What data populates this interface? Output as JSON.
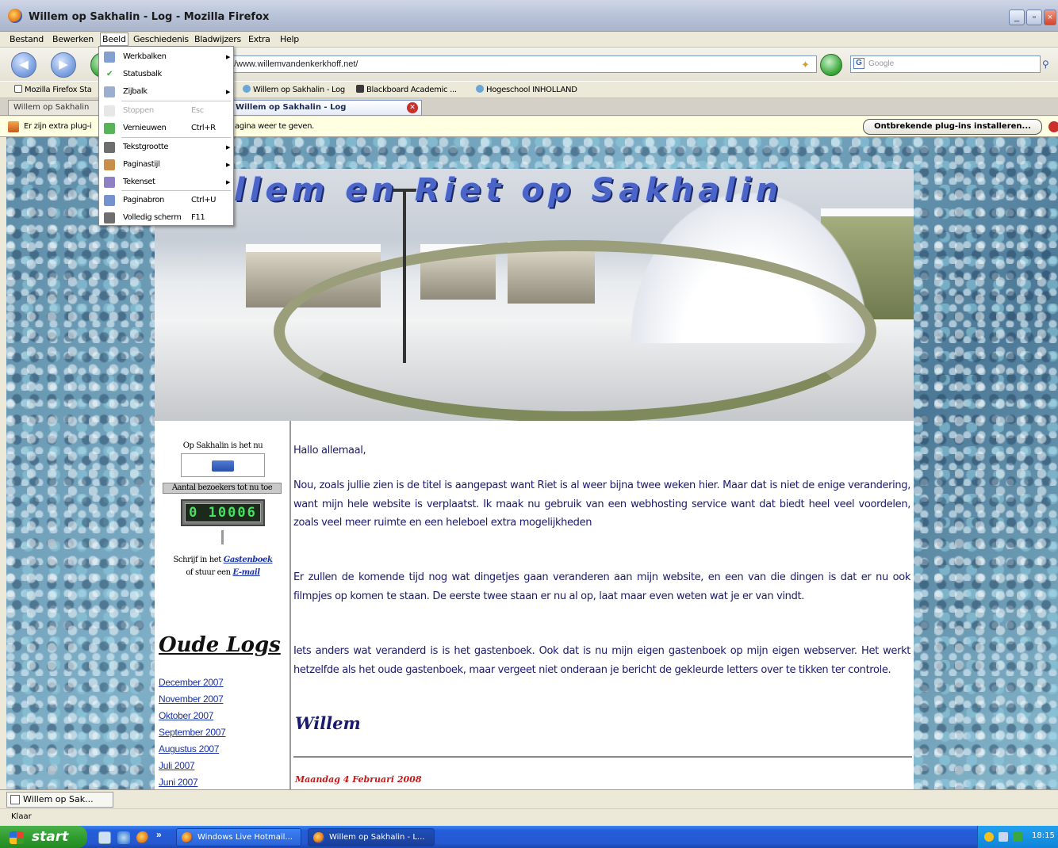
{
  "window": {
    "title": "Willem op Sakhalin - Log - Mozilla Firefox"
  },
  "menubar": {
    "items": [
      "Bestand",
      "Bewerken",
      "Beeld",
      "Geschiedenis",
      "Bladwijzers",
      "Extra",
      "Help"
    ]
  },
  "navbar": {
    "url": "://www.willemvandenkerkhoff.net/",
    "search_placeholder": "Google"
  },
  "bookmarks": [
    "Mozilla Firefox Sta",
    "Willem op Sakhalin - Log",
    "Blackboard Academic ...",
    "Hogeschool INHOLLAND"
  ],
  "tabs": [
    {
      "label": "Willem op Sakhalin"
    },
    {
      "label": "Willem op Sakhalin - Log"
    }
  ],
  "notification": {
    "message_start": "Er zijn extra plug-i",
    "message_end": "agina weer te geven.",
    "button": "Ontbrekende plug-ins installeren..."
  },
  "dropdown": {
    "items": [
      {
        "label": "Werkbalken",
        "shortcut": "",
        "submenu": true,
        "disabled": false,
        "icon": "toolbars-icon"
      },
      {
        "label": "Statusbalk",
        "shortcut": "",
        "submenu": false,
        "disabled": false,
        "icon": "checkmark-icon"
      },
      {
        "label": "Zijbalk",
        "shortcut": "",
        "submenu": true,
        "disabled": false,
        "icon": "sidebar-icon"
      },
      {
        "label": "Stoppen",
        "shortcut": "Esc",
        "submenu": false,
        "disabled": true,
        "icon": "stop-icon"
      },
      {
        "label": "Vernieuwen",
        "shortcut": "Ctrl+R",
        "submenu": false,
        "disabled": false,
        "icon": "reload-icon"
      },
      {
        "label": "Tekstgrootte",
        "shortcut": "",
        "submenu": true,
        "disabled": false,
        "icon": "text-size-icon"
      },
      {
        "label": "Paginastijl",
        "shortcut": "",
        "submenu": true,
        "disabled": false,
        "icon": "page-style-icon"
      },
      {
        "label": "Tekenset",
        "shortcut": "",
        "submenu": true,
        "disabled": false,
        "icon": "charset-icon"
      },
      {
        "label": "Paginabron",
        "shortcut": "Ctrl+U",
        "submenu": false,
        "disabled": false,
        "icon": "page-source-icon"
      },
      {
        "label": "Volledig scherm",
        "shortcut": "F11",
        "submenu": false,
        "disabled": false,
        "icon": "fullscreen-icon"
      }
    ]
  },
  "page": {
    "banner_title": "llem en Riet op Sakhalin",
    "sidebar": {
      "time_label": "Op Sakhalin is het nu",
      "visitors_label": "Aantal bezoekers tot nu toe",
      "counter": "0 10006",
      "guestbook_prefix": "Schrijf in het",
      "guestbook_link": "Gastenboek",
      "email_prefix": "of stuur een",
      "email_link": "E-mail",
      "archive_title": "Oude Logs",
      "archive_links": [
        "December 2007",
        "November 2007",
        "Oktober 2007",
        "September 2007",
        "Augustus 2007",
        "Juli 2007",
        "Juni 2007"
      ]
    },
    "post": {
      "greeting": "Hallo allemaal,",
      "p1": "Nou, zoals jullie zien is de titel is aangepast want Riet is al weer bijna twee weken hier. Maar dat is niet de enige verandering, want mijn hele website is verplaatst. Ik maak nu gebruik van een webhosting service want dat biedt heel veel voordelen, zoals veel meer ruimte en een heleboel extra mogelijkheden",
      "p2": "Er zullen de komende tijd nog wat dingetjes gaan veranderen aan mijn website, en een van die dingen is dat er nu ook filmpjes op komen te staan. De eerste twee staan er nu al op, laat maar even weten wat je er van vindt.",
      "p3": "Iets anders wat veranderd is is het gastenboek. Ook dat is nu mijn eigen gastenboek op mijn eigen webserver. Het werkt hetzelfde als het oude gastenboek, maar vergeet niet onderaan je bericht de gekleurde letters over te tikken ter controle.",
      "signature": "Willem",
      "next_date": "Maandag 4 Februari 2008"
    }
  },
  "ff_taskbar": {
    "item": "Willem op Sak..."
  },
  "status": {
    "text": "Klaar"
  },
  "taskbar": {
    "start": "start",
    "items": [
      "Windows Live Hotmail...",
      "Willem op Sakhalin - L..."
    ],
    "clock": "18:15"
  }
}
